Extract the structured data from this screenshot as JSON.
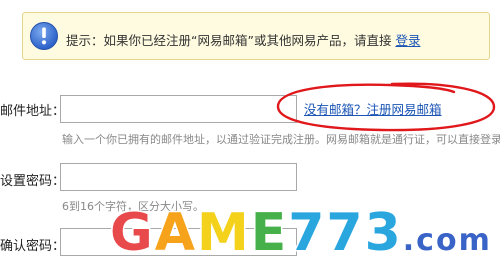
{
  "notice": {
    "icon": "info-icon",
    "text": "提示：如果你已经注册“网易邮箱”或其他网易产品，请直接",
    "login_link": "登录"
  },
  "form": {
    "email": {
      "label": "邮件地址：",
      "value": "",
      "register_link": "没有邮箱？注册网易邮箱",
      "hint": "输入一个你已拥有的邮件地址，以通过验证完成注册。网易邮箱就是通行证，可以直接登录。"
    },
    "password": {
      "label": "设置密码：",
      "value": "",
      "hint": "6到16个字符，区分大小写。"
    },
    "confirm": {
      "label": "确认密码：",
      "value": ""
    }
  },
  "watermark": {
    "text": "GAME773.com",
    "colors": [
      "#e8494b",
      "#f6a21a",
      "#f4d21b",
      "#46b04a",
      "#2aa6df",
      "#3a63c8"
    ]
  },
  "annotation": {
    "color": "#e0181b"
  }
}
